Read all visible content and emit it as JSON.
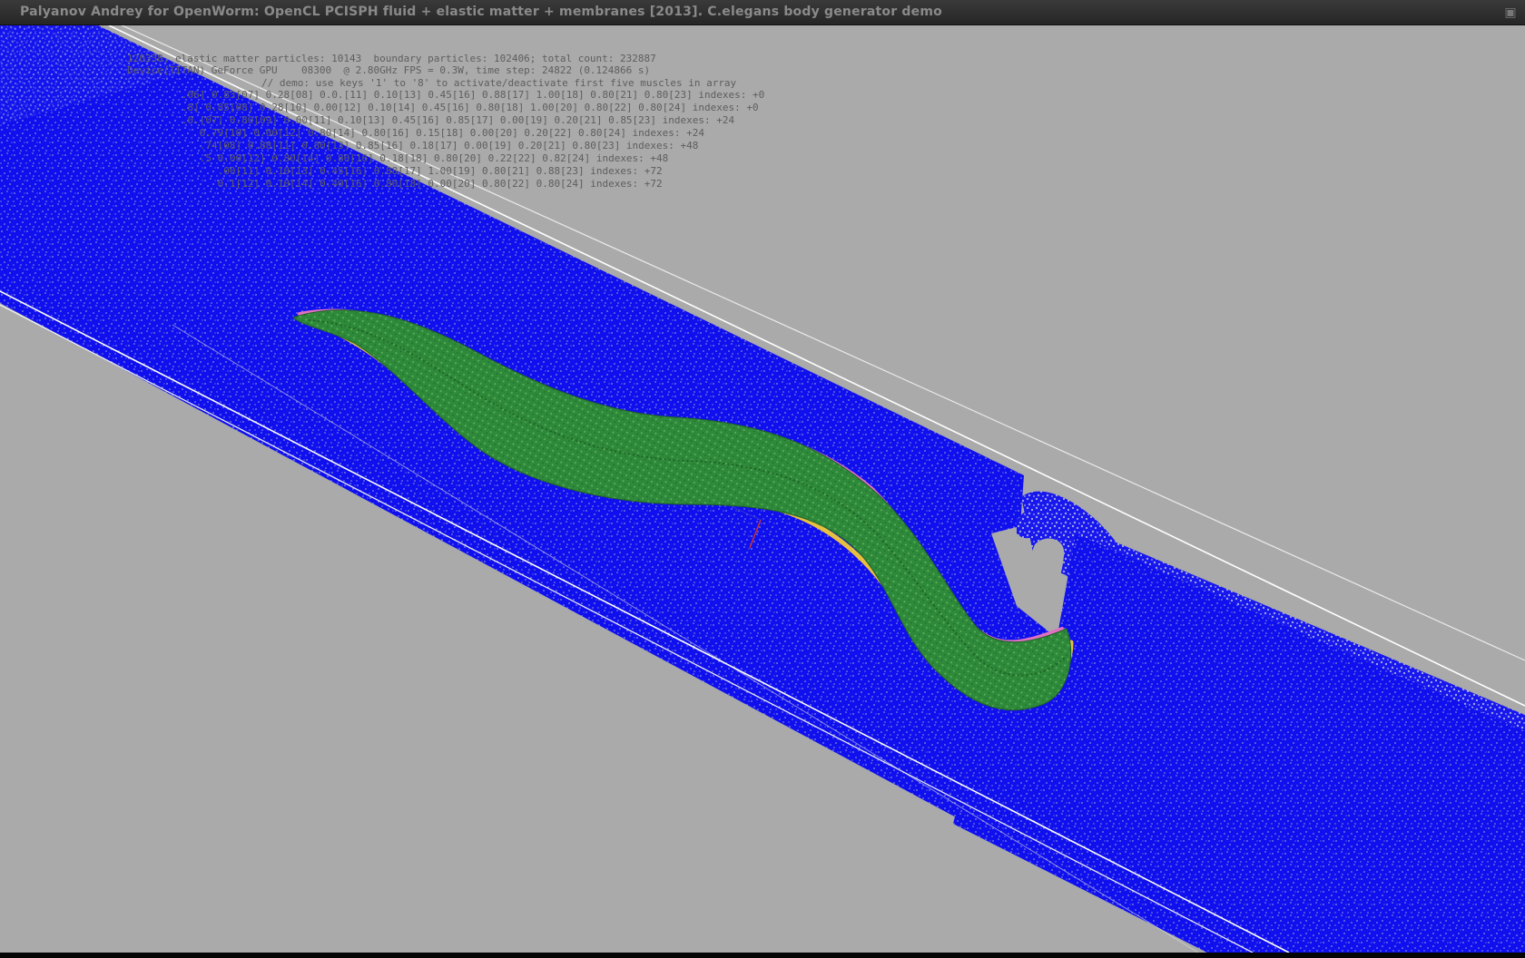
{
  "window": {
    "title": "Palyanov Andrey for OpenWorm: OpenCL PCISPH fluid + elastic matter + membranes [2013]. C.elegans body generator demo",
    "close_glyph": "▣"
  },
  "hud": {
    "stats_line": "120338, elastic matter particles: 10143  boundary particles: 102406; total count: 232887",
    "device_line": "Device(TITAN) GeForce GPU    08300  @ 2.80GHz FPS = 0.3W, time step: 24822 (0.124866 s)",
    "demo_line": "// demo: use keys '1' to '8' to activate/deactivate first five muscles in array",
    "muscle_rows": [
      "   .06] 0.83[07] 0.28[08] 0.0.[11] 0.10[13] 0.45[16] 0.88[17] 1.00[18] 0.80[21] 0.80[23] indexes: +0",
      "   .8] 0.85[08] 0.28[10] 0.00[12] 0.10[14] 0.45[16] 0.80[18] 1.00[20] 0.80[22] 0.80[24] indexes: +0",
      "   .0.[07] 0.80[09] 0.00[11] 0.10[13] 0.45[16] 0.85[17] 0.00[19] 0.20[21] 0.85[23] indexes: +24",
      "      0.79[10] 0.00[12] 0.80[14] 0.80[16] 0.15[18] 0.00[20] 0.20[22] 0.80[24] indexes: +24",
      "      .74[08] 0.88[11] 0.80[13] 0.85[16] 0.18[17] 0.00[19] 0.20[21] 0.80[23] indexes: +48",
      "      .5 0.00[12] 0.80[14] 0.80[16] 0.18[18] 0.80[20] 0.22[22] 0.82[24] indexes: +48",
      "         .00[11] 0.10[13] 0.45[16] 0.88[17] 1.00[19] 0.80[21] 0.88[23] indexes: +72",
      "         0.1[12] 0.10[14] 0.40[16] 0.80[18] 0.00[20] 0.80[22] 0.80[24] indexes: +72"
    ]
  },
  "scene": {
    "colors": {
      "background": "#aaaaaa",
      "fluid": "#1010ee",
      "fluid_particle": "#8a8fd8",
      "worm_body": "#2e8a3a",
      "worm_dot": "#66bb66",
      "worm_edge_top": "#e070c0",
      "worm_edge_bottom": "#e8c040",
      "boundary": "#ffffff"
    }
  }
}
